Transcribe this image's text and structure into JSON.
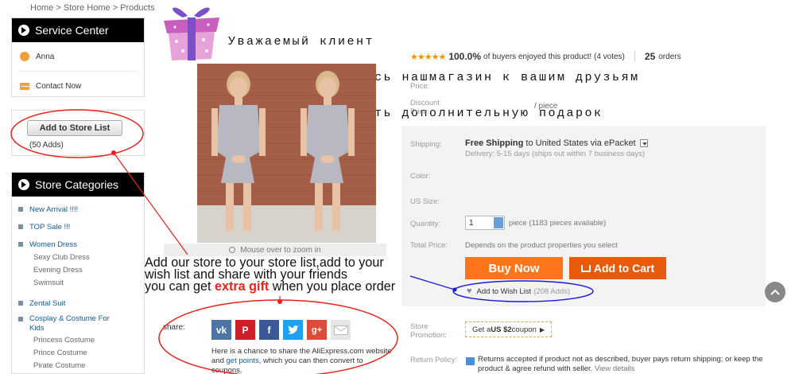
{
  "breadcrumb": {
    "home": "Home",
    "store_home": "Store Home",
    "products": "Products",
    "sep": ">"
  },
  "service_center": {
    "title": "Service Center",
    "agent_name": "Anna",
    "contact": "Contact Now"
  },
  "store_list": {
    "button": "Add to Store List",
    "adds": "(50 Adds)"
  },
  "categories": {
    "title": "Store Categories",
    "items": [
      "New Arrival !!!!",
      "TOP Sale !!!",
      "Women Dress",
      "Sexy Club Dress",
      "Evening Dress",
      "Swimsuit",
      "Zental Suit",
      "Cosplay & Costume For Kids",
      "Princess Costume",
      "Prince Costume",
      "Pirate Costume"
    ]
  },
  "promo": {
    "line1": "Уважаемый клиент",
    "line2": "если Вы поделитесь нашмагазин к вашим друзьям",
    "line3": "вы можете получить дополнительную подарок"
  },
  "image": {
    "zoom_note": "Mouse over to zoom in"
  },
  "annotation": {
    "line1": "Add our store to your store list,add to your",
    "line2": "wish list and share with your friends",
    "line3_pre": "you can get ",
    "line3_gift": "extra gift",
    "line3_post": " when you place order"
  },
  "share": {
    "label": "share:",
    "text_pre": "Here is a chance to share the AliExpress.com website and ",
    "text_link": "get points",
    "text_post": ", which you can then convert to coupons."
  },
  "rating": {
    "stars": "★★★★★",
    "percent": "100.0%",
    "text": "of buyers enjoyed this product! (4 votes)",
    "orders_num": "25",
    "orders_label": "orders"
  },
  "fields": {
    "price": "Price:",
    "discount_price": "Discount Price:",
    "per_piece": "/ piece",
    "shipping": "Shipping:",
    "color": "Color:",
    "us_size": "US Size:",
    "quantity": "Quantity:",
    "total_price": "Total Price:",
    "store_promotion": "Store Promotion:",
    "return_policy": "Return Policy:"
  },
  "shipping": {
    "free": "Free Shipping",
    "to": "to",
    "country": "United States via ePacket",
    "delivery": "Delivery: 5-15 days (ships out within 7 business days)"
  },
  "quantity": {
    "value": "1",
    "note": "piece (1183 pieces available)"
  },
  "total_note": "Depends on the product properties you select",
  "buttons": {
    "buy_now": "Buy Now",
    "add_to_cart": "Add to Cart"
  },
  "wish_list": {
    "label": "Add to Wish List",
    "adds": "(208 Adds)"
  },
  "coupon": {
    "pre": "Get a ",
    "amount": "US $2",
    "post": " coupon"
  },
  "return_policy": {
    "text": "Returns accepted if product not as described, buyer pays return shipping; or keep the product & agree refund with seller.",
    "link": "View details"
  },
  "colors": {
    "buy_now": "#ff7519",
    "add_to_cart": "#e85a0c",
    "annotation_red": "#e8231a",
    "annotation_blue": "#1a1ad6",
    "stars": "#f39200"
  }
}
